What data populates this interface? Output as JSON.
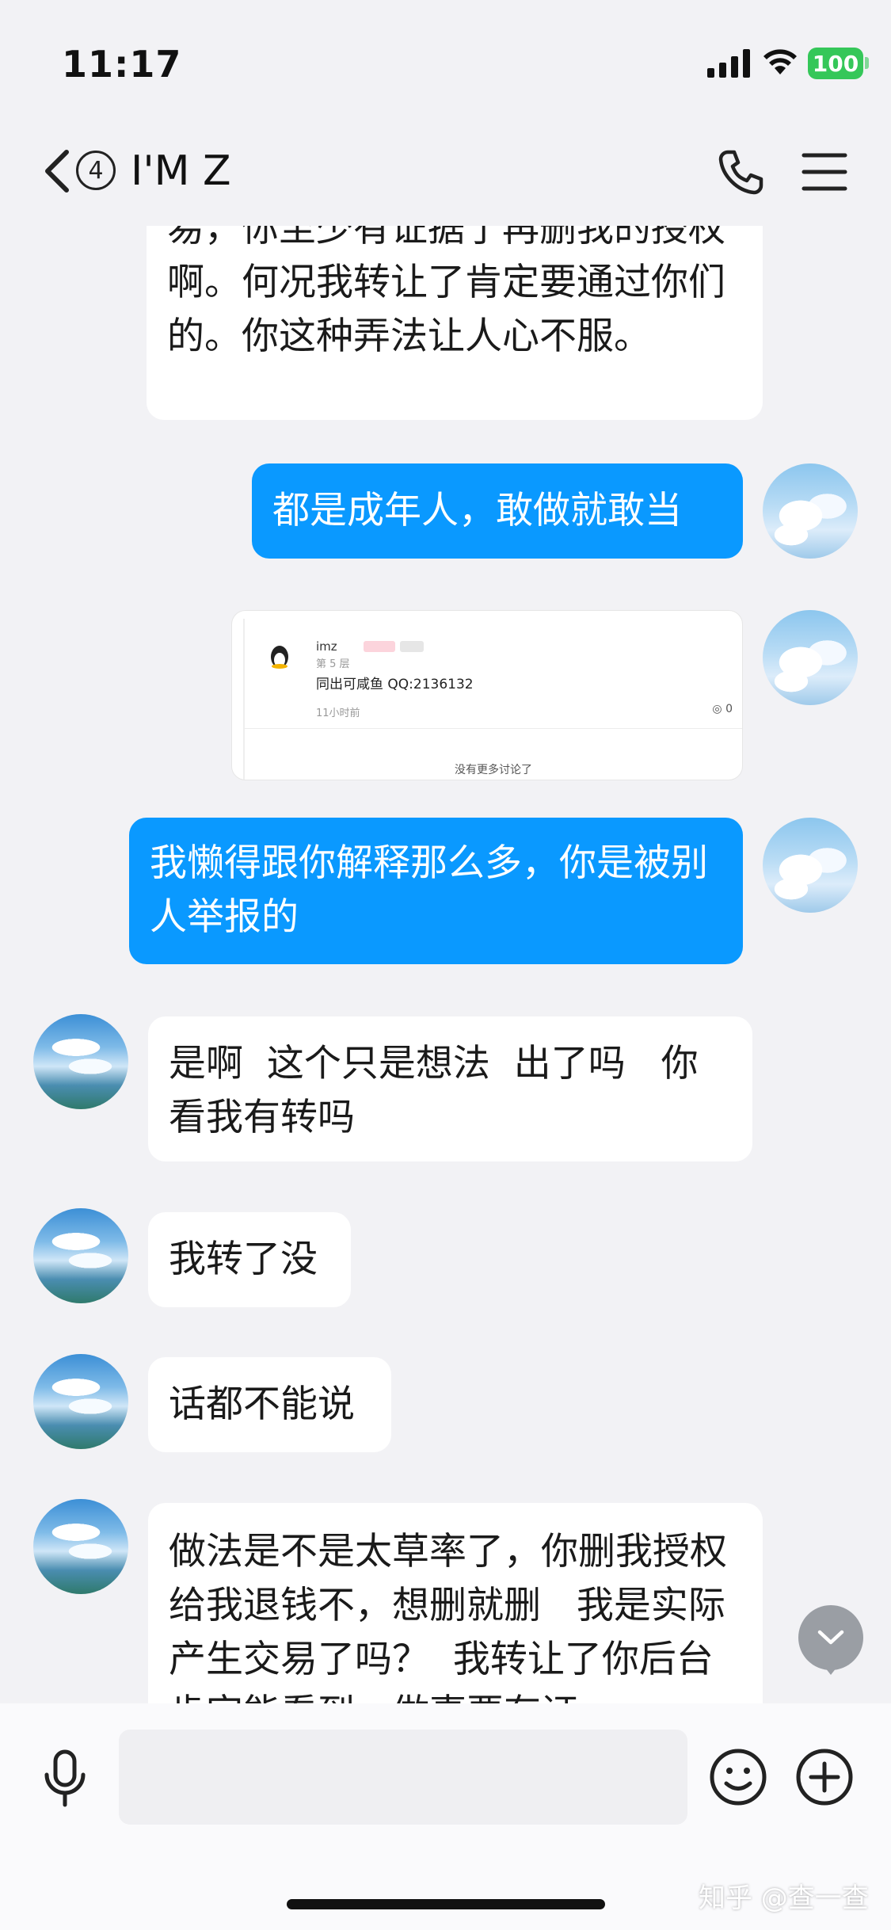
{
  "status_bar": {
    "time": "11:17",
    "battery": "100"
  },
  "nav": {
    "unread_count": "4",
    "contact_name": "I'M Z"
  },
  "messages": [
    {
      "side": "in",
      "text": "易，你至少有证据了再删我的授权啊。何况我转让了肯定要通过你们的。你这种弄法让人心不服。"
    },
    {
      "side": "out",
      "text": "都是成年人，敢做就敢当"
    },
    {
      "side": "out",
      "type": "image"
    },
    {
      "side": "out",
      "text": "我懒得跟你解释那么多，你是被别人举报的"
    },
    {
      "side": "in",
      "text": "是啊  这个只是想法  出了吗   你看我有转吗"
    },
    {
      "side": "in",
      "text": "我转了没"
    },
    {
      "side": "in",
      "text": "话都不能说"
    },
    {
      "side": "in",
      "text": "做法是不是太草率了，你删我授权给我退钱不，想删就删   我是实际产生交易了吗？  我转让了你后台肯定能看到，做事要有证"
    }
  ],
  "shared_card": {
    "username": "imz",
    "floor": "第 5 层",
    "content": "同出可咸鱼 QQ:2136132",
    "time": "11小时前",
    "comment_count": "0",
    "footer": "没有更多讨论了"
  },
  "input": {
    "placeholder": ""
  },
  "watermark": "知乎 @查一查",
  "colors": {
    "outgoing_bubble": "#0a99ff",
    "incoming_bubble": "#ffffff",
    "background": "#f2f2f5",
    "battery": "#35c759"
  },
  "icons": [
    "back-chevron-icon",
    "phone-icon",
    "menu-icon",
    "microphone-icon",
    "emoji-icon",
    "plus-icon",
    "chevron-down-icon"
  ]
}
